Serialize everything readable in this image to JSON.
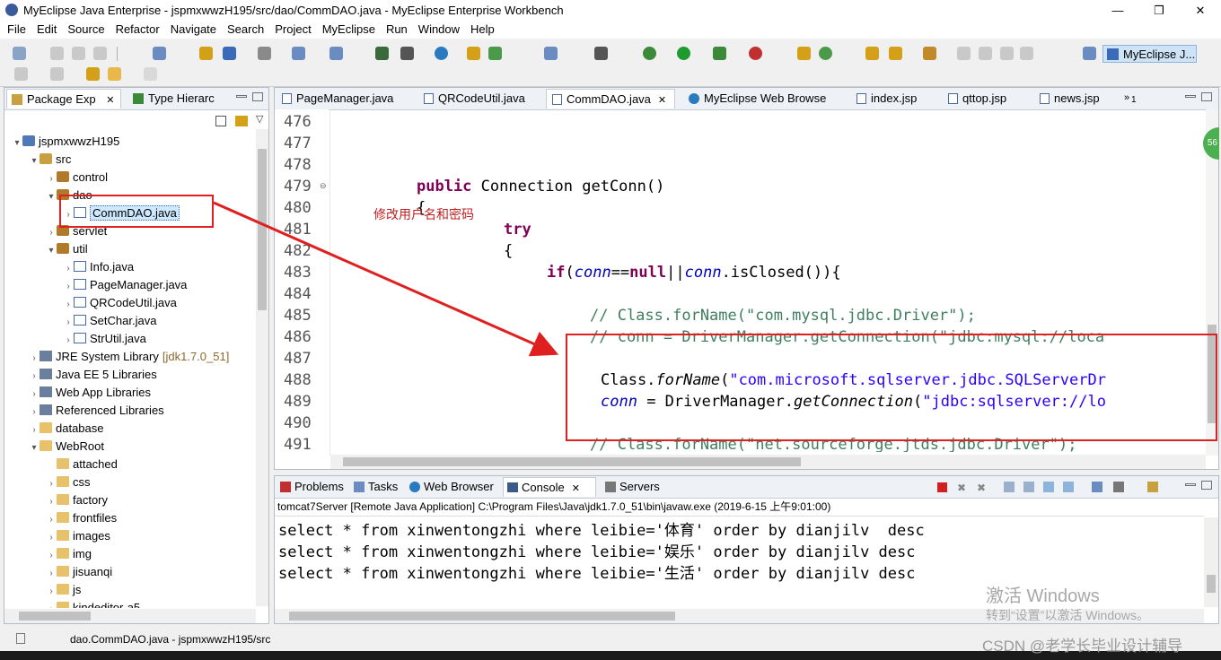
{
  "window": {
    "title": "MyEclipse Java Enterprise - jspmxwwzH195/src/dao/CommDAO.java - MyEclipse Enterprise Workbench",
    "minimize": "—",
    "maximize": "❐",
    "close": "✕"
  },
  "menu": [
    "File",
    "Edit",
    "Source",
    "Refactor",
    "Navigate",
    "Search",
    "Project",
    "MyEclipse",
    "Run",
    "Window",
    "Help"
  ],
  "perspective": "MyEclipse J...",
  "left_panel": {
    "tabs": [
      "Package Exp",
      "Type Hierarc"
    ],
    "tree": [
      {
        "label": "jspmxwwzH195",
        "indent": 0,
        "twisty": "▾",
        "icon": "project"
      },
      {
        "label": "src",
        "indent": 1,
        "twisty": "▾",
        "icon": "src"
      },
      {
        "label": "control",
        "indent": 2,
        "twisty": "›",
        "icon": "package"
      },
      {
        "label": "dao",
        "indent": 2,
        "twisty": "▾",
        "icon": "package"
      },
      {
        "label": "CommDAO.java",
        "indent": 3,
        "twisty": "›",
        "icon": "java",
        "selected": true
      },
      {
        "label": "servlet",
        "indent": 2,
        "twisty": "›",
        "icon": "package"
      },
      {
        "label": "util",
        "indent": 2,
        "twisty": "▾",
        "icon": "package"
      },
      {
        "label": "Info.java",
        "indent": 3,
        "twisty": "›",
        "icon": "java"
      },
      {
        "label": "PageManager.java",
        "indent": 3,
        "twisty": "›",
        "icon": "java"
      },
      {
        "label": "QRCodeUtil.java",
        "indent": 3,
        "twisty": "›",
        "icon": "java"
      },
      {
        "label": "SetChar.java",
        "indent": 3,
        "twisty": "›",
        "icon": "java"
      },
      {
        "label": "StrUtil.java",
        "indent": 3,
        "twisty": "›",
        "icon": "java"
      },
      {
        "label": "JRE System Library",
        "suffix": "[jdk1.7.0_51]",
        "indent": 1,
        "twisty": "›",
        "icon": "library"
      },
      {
        "label": "Java EE 5 Libraries",
        "indent": 1,
        "twisty": "›",
        "icon": "library"
      },
      {
        "label": "Web App Libraries",
        "indent": 1,
        "twisty": "›",
        "icon": "library"
      },
      {
        "label": "Referenced Libraries",
        "indent": 1,
        "twisty": "›",
        "icon": "library"
      },
      {
        "label": "database",
        "indent": 1,
        "twisty": "›",
        "icon": "folder"
      },
      {
        "label": "WebRoot",
        "indent": 1,
        "twisty": "▾",
        "icon": "folder"
      },
      {
        "label": "attached",
        "indent": 2,
        "twisty": "",
        "icon": "folder"
      },
      {
        "label": "css",
        "indent": 2,
        "twisty": "›",
        "icon": "folder"
      },
      {
        "label": "factory",
        "indent": 2,
        "twisty": "›",
        "icon": "folder"
      },
      {
        "label": "frontfiles",
        "indent": 2,
        "twisty": "›",
        "icon": "folder"
      },
      {
        "label": "images",
        "indent": 2,
        "twisty": "›",
        "icon": "folder"
      },
      {
        "label": "img",
        "indent": 2,
        "twisty": "›",
        "icon": "folder"
      },
      {
        "label": "jisuanqi",
        "indent": 2,
        "twisty": "›",
        "icon": "folder"
      },
      {
        "label": "js",
        "indent": 2,
        "twisty": "›",
        "icon": "folder"
      },
      {
        "label": "kindeditor-a5",
        "indent": 2,
        "twisty": "›",
        "icon": "folder"
      }
    ]
  },
  "editor": {
    "tabs": [
      "PageManager.java",
      "QRCodeUtil.java",
      "CommDAO.java",
      "MyEclipse Web Browse",
      "index.jsp",
      "qttop.jsp",
      "news.jsp"
    ],
    "overflow_count": "1",
    "overview_badge": "56",
    "line_numbers": [
      "476",
      "477",
      "478",
      "479",
      "480",
      "481",
      "482",
      "483",
      "484",
      "485",
      "486",
      "487",
      "488",
      "489",
      "490",
      "491"
    ],
    "annotation": "修改用户名和密码",
    "code": {
      "l479_kw": "public",
      "l479_rest": " Connection getConn()",
      "l480": "{",
      "l481": "try",
      "l482": "{",
      "l483_kw": "if",
      "l483_a": "(",
      "l483_conn1": "conn",
      "l483_b": "==",
      "l483_null": "null",
      "l483_c": "||",
      "l483_conn2": "conn",
      "l483_d": ".isClosed()){",
      "l485": "// Class.forName(\"com.mysql.jdbc.Driver\");",
      "l486": "// conn = DriverManager.getConnection(\"jdbc:mysql://loca",
      "l488_a": "Class.",
      "l488_m": "forName",
      "l488_b": "(",
      "l488_s": "\"com.microsoft.sqlserver.jdbc.SQLServerDr",
      "l489_conn": "conn",
      "l489_a": " = DriverManager.",
      "l489_m": "getConnection",
      "l489_b": "(",
      "l489_s": "\"jdbc:sqlserver://lo",
      "l491": "// Class.forName(\"net.sourceforge.jtds.jdbc.Driver\");"
    }
  },
  "console": {
    "tabs": [
      "Problems",
      "Tasks",
      "Web Browser",
      "Console",
      "Servers"
    ],
    "description": "tomcat7Server [Remote Java Application] C:\\Program Files\\Java\\jdk1.7.0_51\\bin\\javaw.exe (2019-6-15 上午9:01:00)",
    "lines": [
      "select * from xinwentongzhi where leibie='体育' order by dianjilv  desc",
      "select * from xinwentongzhi where leibie='娱乐' order by dianjilv desc",
      "select * from xinwentongzhi where leibie='生活' order by dianjilv desc"
    ]
  },
  "status_bar": {
    "path": "dao.CommDAO.java - jspmxwwzH195/src"
  },
  "watermarks": {
    "activate_title": "激活 Windows",
    "activate_sub": "转到“设置”以激活 Windows。",
    "csdn": "CSDN @老学长毕业设计辅导"
  },
  "colors": {
    "keyword": "#7f0055",
    "field": "#0000c0",
    "string": "#2a00ff",
    "comment": "#3f7f5f",
    "highlight": "#e02020"
  }
}
